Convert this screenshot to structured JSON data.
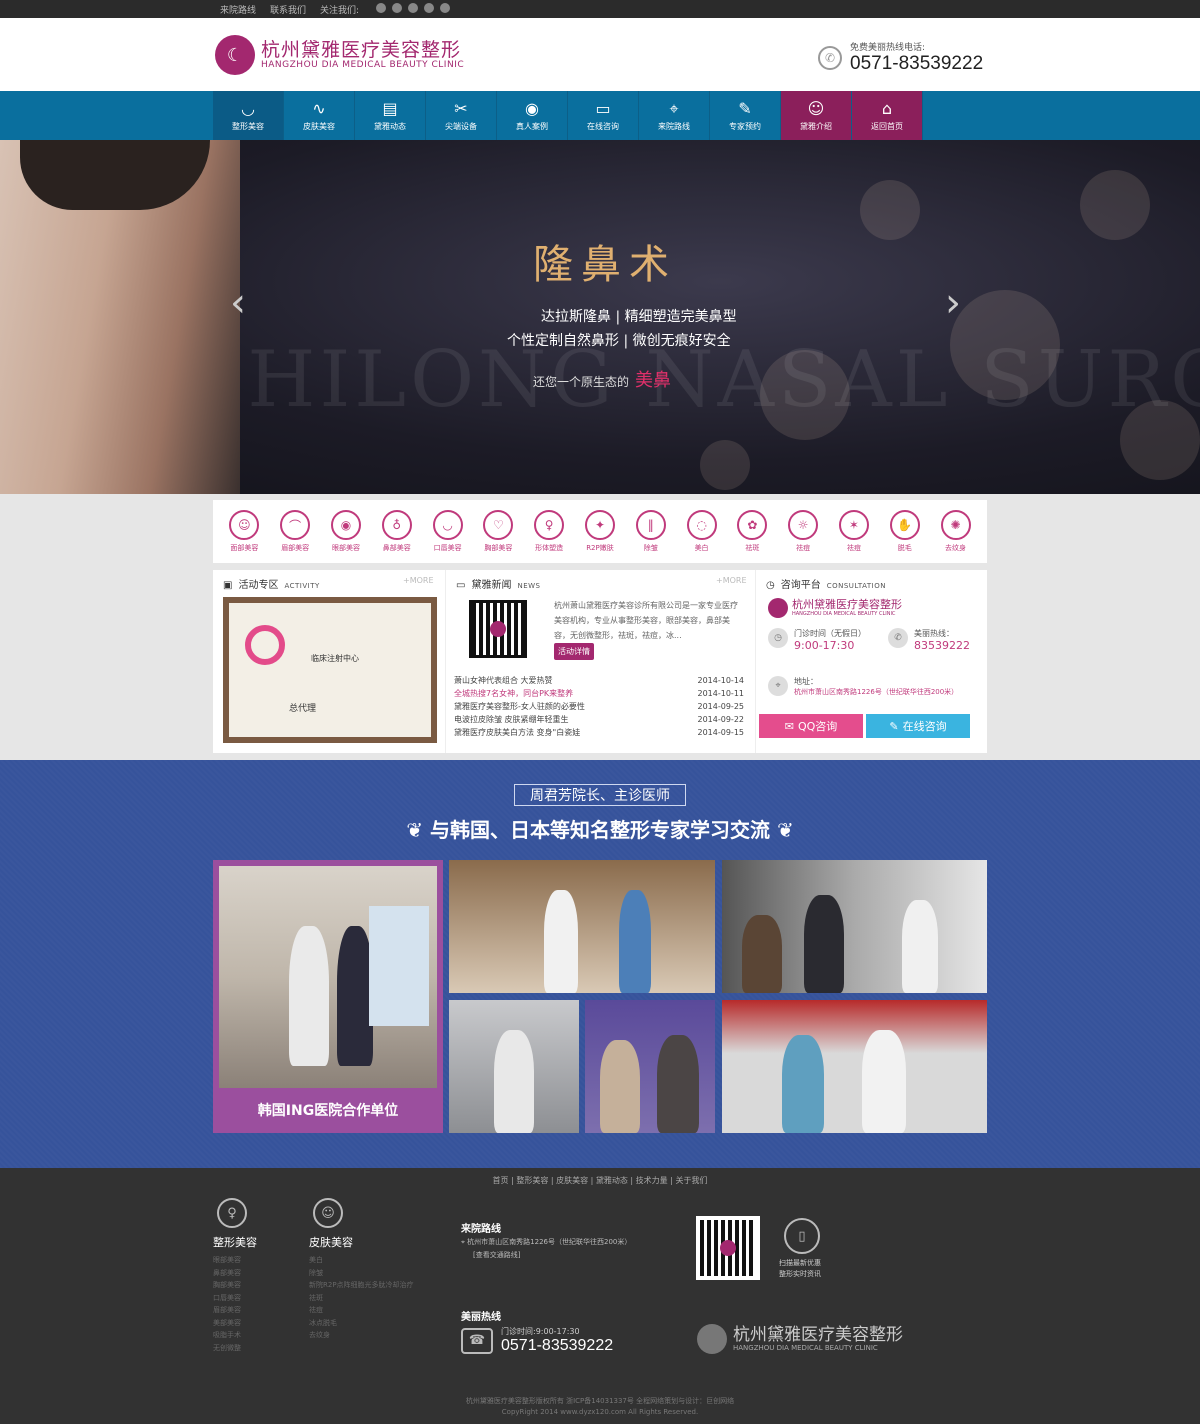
{
  "topbar": {
    "items": [
      "来院路线",
      "联系我们",
      "关注我们:"
    ]
  },
  "logo": {
    "cn": "杭州黛雅医疗美容整形",
    "en": "HANGZHOU DIA MEDICAL BEAUTY CLINIC"
  },
  "hotline": {
    "label": "免费美丽热线电话:",
    "number": "0571-83539222"
  },
  "nav": [
    {
      "label": "整形美容",
      "icon": "face-icon",
      "glyph": "◡"
    },
    {
      "label": "皮肤美容",
      "icon": "skin-icon",
      "glyph": "∿"
    },
    {
      "label": "黛雅动态",
      "icon": "bookmark-icon",
      "glyph": "▤"
    },
    {
      "label": "尖端设备",
      "icon": "tools-icon",
      "glyph": "✂"
    },
    {
      "label": "真人案例",
      "icon": "eye-icon",
      "glyph": "◉"
    },
    {
      "label": "在线咨询",
      "icon": "chat-icon",
      "glyph": "▭"
    },
    {
      "label": "来院路线",
      "icon": "location-icon",
      "glyph": "⌖"
    },
    {
      "label": "专家预约",
      "icon": "clipboard-icon",
      "glyph": "✎"
    },
    {
      "label": "黛雅介绍",
      "icon": "user-icon",
      "glyph": "☺"
    },
    {
      "label": "返回首页",
      "icon": "home-icon",
      "glyph": "⌂"
    }
  ],
  "hero": {
    "bg_word": "SHILONG NASAL SURGERY",
    "title": "隆鼻术",
    "line1": "达拉斯隆鼻 | 精细塑造完美鼻型",
    "line2": "个性定制自然鼻形 | 微创无痕好安全",
    "line3": "还您一个原生态的",
    "line3_em": "美鼻"
  },
  "categories": [
    "面部美容",
    "眉部美容",
    "眼部美容",
    "鼻部美容",
    "口唇美容",
    "胸部美容",
    "形体塑造",
    "R2P嫩肤",
    "除皱",
    "美白",
    "祛斑",
    "祛痘",
    "祛痘",
    "脱毛",
    "去纹身"
  ],
  "activity": {
    "title": "活动专区",
    "en": "ACTIVITY",
    "more": "+MORE",
    "cert_title": "临床注射中心",
    "cert_agent": "总代理"
  },
  "news": {
    "title": "黛雅新闻",
    "en": "NEWS",
    "more": "+MORE",
    "intro": "杭州萧山黛雅医疗美容诊所有限公司是一家专业医疗美容机构，专业从事整形美容，眼部美容，鼻部美容，无创微整形，祛斑，祛痘，冰...",
    "detail": "活动详情",
    "items": [
      {
        "t": "萧山女神代表组合 大爱热赞",
        "d": "2014-10-14"
      },
      {
        "t": "全城热搜7名女神，同台PK来整养",
        "d": "2014-10-11"
      },
      {
        "t": "黛雅医疗美容整形-女人驻颜的必要性",
        "d": "2014-09-25"
      },
      {
        "t": "电波拉皮除皱 皮肤紧绷年轻重生",
        "d": "2014-09-22"
      },
      {
        "t": "黛雅医疗皮肤美白方法 变身\"白瓷娃",
        "d": "2014-09-15"
      }
    ]
  },
  "consult": {
    "title": "咨询平台",
    "en": "CONSULTATION",
    "hours_label": "门诊时间（无假日）",
    "hours": "9:00-17:30",
    "hot_label": "美丽热线：",
    "hot": "83539222",
    "addr_label": "地址：",
    "addr": "杭州市萧山区南秀路1226号（世纪联华往西200米）",
    "qq": "QQ咨询",
    "online": "在线咨询"
  },
  "expert": {
    "badge": "周君芳院长、主诊医师",
    "title": "与韩国、日本等知名整形专家学习交流",
    "caption": "韩国ING医院合作单位"
  },
  "footer": {
    "links": "首页 | 整形美容 | 皮肤美容 | 黛雅动态 | 技术力量 | 关于我们",
    "col1": {
      "title": "整形美容",
      "items": [
        "眼部美容",
        "鼻部美容",
        "胸部美容",
        "口唇美容",
        "眉部美容",
        "美部美容",
        "吸脂手术",
        "无创微整"
      ]
    },
    "col2": {
      "title": "皮肤美容",
      "items": [
        "美白",
        "除皱",
        "新院R2P点阵细胞光多肽冷却治疗",
        "祛斑",
        "祛痘",
        "冰点脱毛",
        "去纹身"
      ]
    },
    "route_title": "来院路线",
    "route_addr": "杭州市萧山区南秀路1226号（世纪联华往西200米）",
    "route_link": "[查看交通路线]",
    "beauty_title": "美丽热线",
    "hours": "门诊时间:9:00-17:30",
    "phone": "0571-83539222",
    "scan1": "扫描最新优惠",
    "scan2": "整形实时资讯",
    "logo_cn": "杭州黛雅医疗美容整形",
    "logo_en": "HANGZHOU DIA MEDICAL BEAUTY CLINIC",
    "copy1": "杭州黛雅医疗美容整形版权所有 浙ICP备14031337号 全程网络策划与设计：巨创网络",
    "copy2": "CopyRight 2014 www.dyzx120.com All Rights Reserved."
  }
}
